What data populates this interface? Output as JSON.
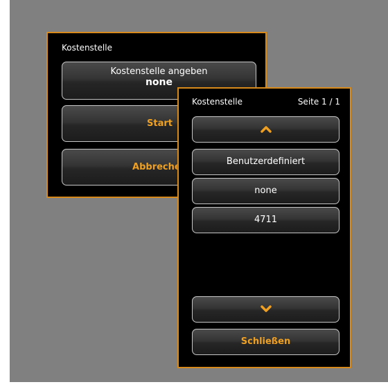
{
  "back_dialog": {
    "title": "Kostenstelle",
    "cost_center_button": {
      "label": "Kostenstelle angeben",
      "value": "none"
    },
    "start_label": "Start",
    "cancel_label": "Abbrechen"
  },
  "front_dialog": {
    "title": "Kostenstelle",
    "page_indicator": "Seite 1 / 1",
    "scroll_up_icon": "chevron-up-icon",
    "items": [
      {
        "label": "Benutzerdefiniert"
      },
      {
        "label": "none"
      },
      {
        "label": "4711"
      }
    ],
    "scroll_down_icon": "chevron-down-icon",
    "close_label": "Schließen"
  },
  "colors": {
    "accent": "#f0a020",
    "panel_border": "#d88a1a",
    "panel_bg": "#000000",
    "backdrop": "#808080"
  }
}
